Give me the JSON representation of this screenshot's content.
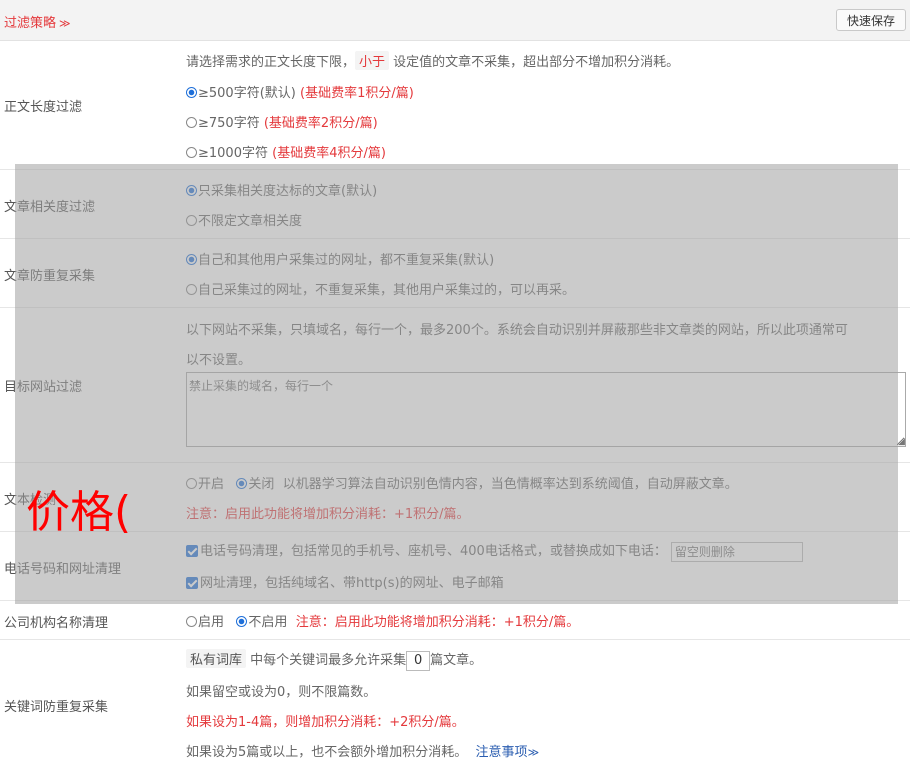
{
  "header": {
    "title": "过滤策略",
    "chevron": "≫",
    "save_button": "快速保存"
  },
  "length_filter": {
    "label": "正文长度过滤",
    "desc_before": "请选择需求的正文长度下限，",
    "desc_tag": "小于",
    "desc_after": "设定值的文章不采集，超出部分不增加积分消耗。",
    "options": [
      {
        "text": "≥500字符(默认)",
        "note": "(基础费率1积分/篇)",
        "selected": true
      },
      {
        "text": "≥750字符",
        "note": "(基础费率2积分/篇)",
        "selected": false
      },
      {
        "text": "≥1000字符",
        "note": "(基础费率4积分/篇)",
        "selected": false
      }
    ]
  },
  "relevance_filter": {
    "label": "文章相关度过滤",
    "options": [
      {
        "text": "只采集相关度达标的文章(默认)",
        "selected": true
      },
      {
        "text": "不限定文章相关度",
        "selected": false
      }
    ]
  },
  "dedupe": {
    "label": "文章防重复采集",
    "options": [
      {
        "text": "自己和其他用户采集过的网址，都不重复采集(默认)",
        "selected": true
      },
      {
        "text": "自己采集过的网址，不重复采集，其他用户采集过的，可以再采。",
        "selected": false
      }
    ]
  },
  "site_filter": {
    "label": "目标网站过滤",
    "desc_line1": "以下网站不采集，只填域名，每行一个，最多200个。系统会自动识别并屏蔽那些非文章类的网站，所以此项通常可",
    "desc_line2": "以不设置。",
    "placeholder": "禁止采集的域名，每行一个"
  },
  "text_safety": {
    "label": "文本检测",
    "on_label": "开启",
    "off_label": "关闭",
    "desc": "以机器学习算法自动识别色情内容，当色情概率达到系统阈值，自动屏蔽文章。",
    "note": "注意：启用此功能将增加积分消耗：+1积分/篇。"
  },
  "contact_clean": {
    "label": "电话号码和网址清理",
    "phone_text": "电话号码清理，包括常见的手机号、座机号、400电话格式，或替换成如下电话：",
    "phone_placeholder": "留空则删除",
    "url_text": "网址清理，包括纯域名、带http(s)的网址、电子邮箱"
  },
  "company_clean": {
    "label": "公司机构名称清理",
    "on_label": "启用",
    "off_label": "不启用",
    "note": "注意：启用此功能将增加积分消耗：+1积分/篇。"
  },
  "keyword_dedupe": {
    "label": "关键词防重复采集",
    "tag": "私有词库",
    "text_before": "中每个关键词最多允许采集",
    "value": "0",
    "text_after": "篇文章。",
    "line2": "如果留空或设为0，则不限篇数。",
    "line3": "如果设为1-4篇，则增加积分消耗：+2积分/篇。",
    "line4": "如果设为5篇或以上，也不会额外增加积分消耗。",
    "notice_link": "注意事项",
    "notice_chevron": "≫"
  },
  "overlay_text": "价格("
}
